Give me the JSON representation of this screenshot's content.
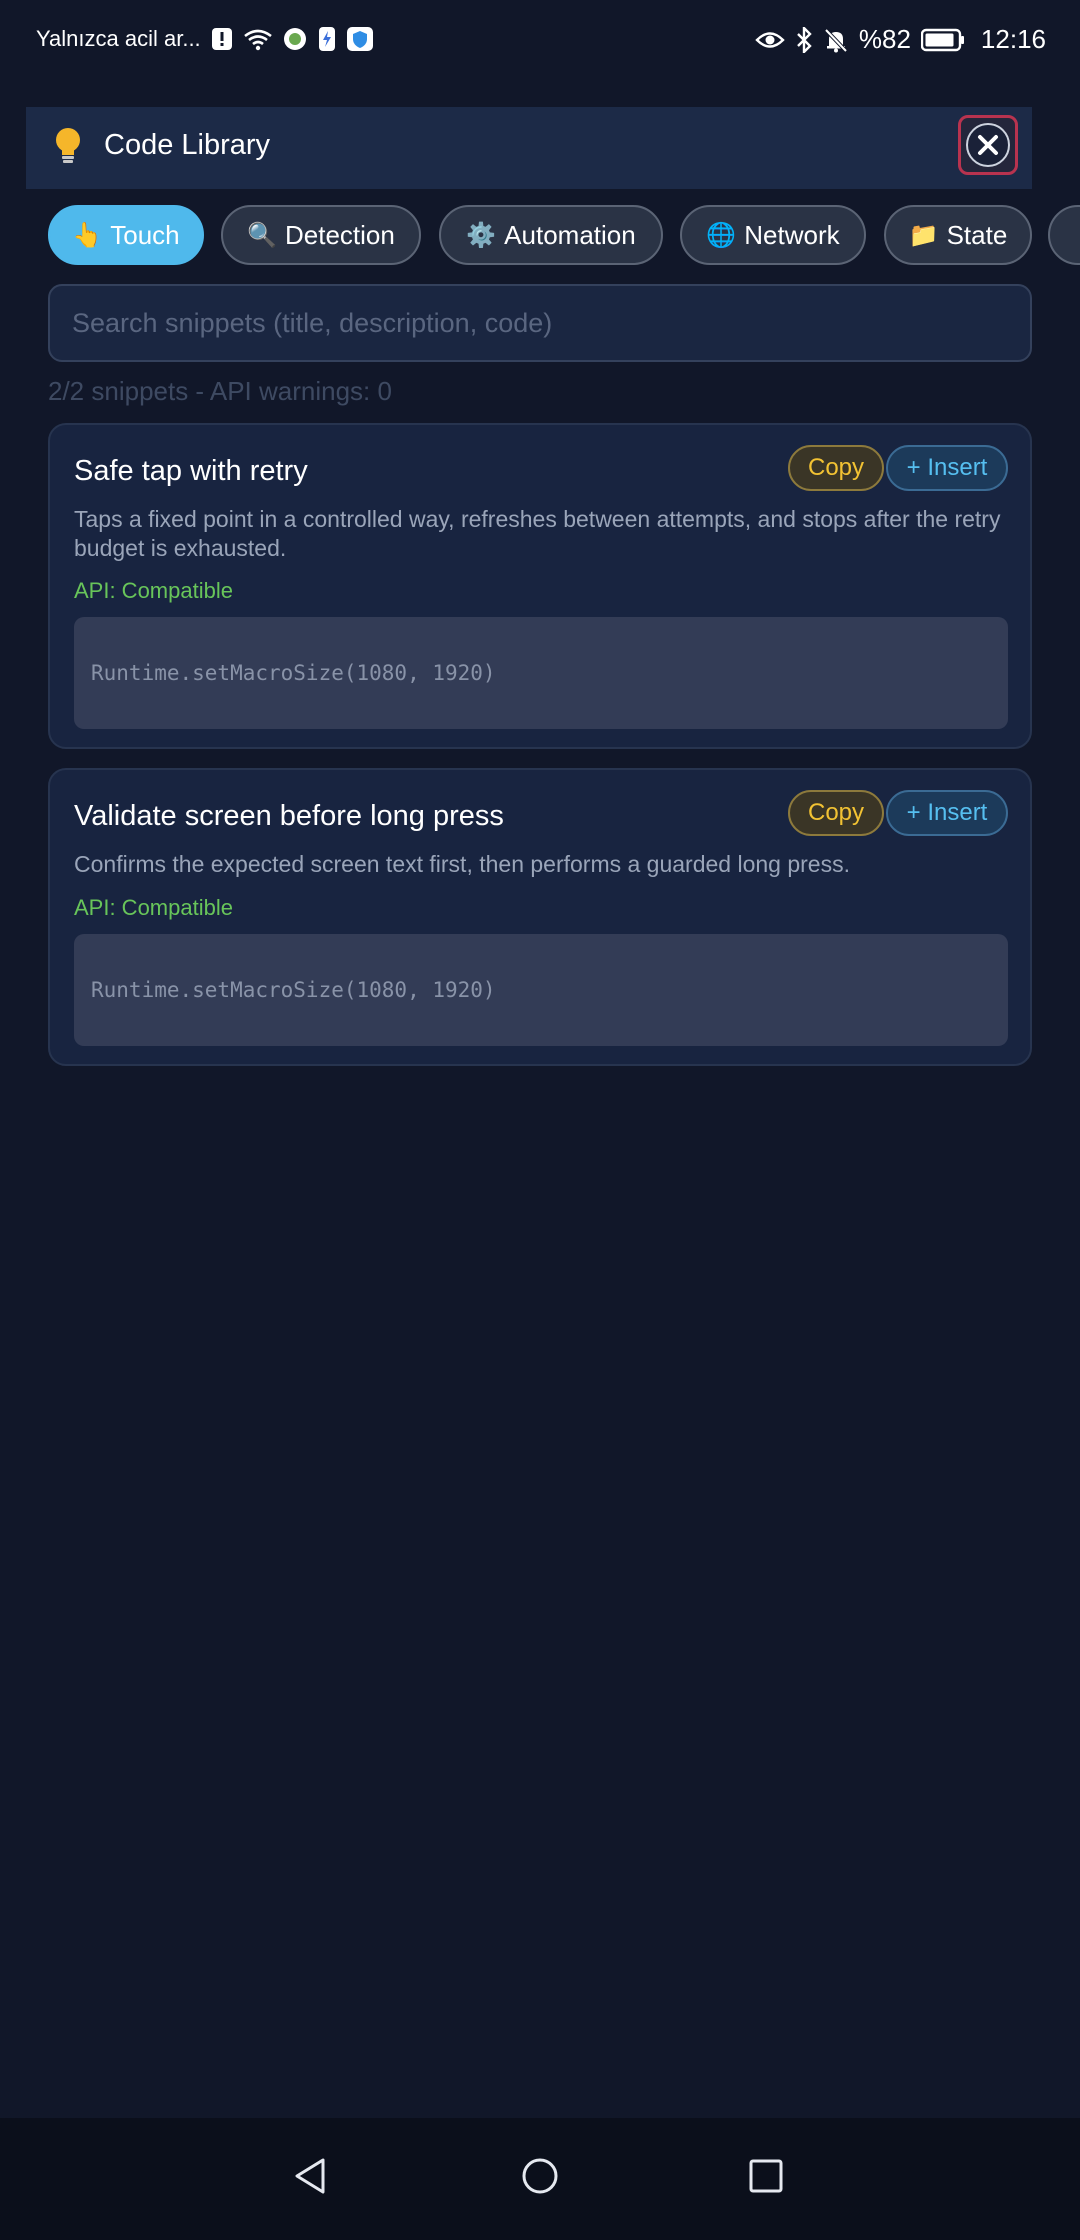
{
  "status_bar": {
    "carrier_text": "Yalnızca acil ar...",
    "battery": "%82",
    "time": "12:16"
  },
  "header": {
    "title": "Code Library",
    "icon": "lightbulb-icon",
    "close_icon": "close-icon"
  },
  "tabs": [
    {
      "emoji": "👆",
      "label": "Touch",
      "active": true
    },
    {
      "emoji": "🔍",
      "label": "Detection",
      "active": false
    },
    {
      "emoji": "⚙️",
      "label": "Automation",
      "active": false
    },
    {
      "emoji": "🌐",
      "label": "Network",
      "active": false
    },
    {
      "emoji": "📁",
      "label": "State",
      "active": false
    }
  ],
  "search": {
    "placeholder": "Search snippets (title, description, code)",
    "value": ""
  },
  "summary": "2/2 snippets - API warnings: 0",
  "snippets": [
    {
      "title": "Safe tap with retry",
      "copy_label": "Copy",
      "insert_label": "+ Insert",
      "description": "Taps a fixed point in a controlled way, refreshes between attempts, and stops after the retry budget is exhausted.",
      "api": "API: Compatible",
      "code": "Runtime.setMacroSize(1080, 1920)"
    },
    {
      "title": "Validate screen before long press",
      "copy_label": "Copy",
      "insert_label": "+ Insert",
      "description": "Confirms the expected screen text first, then performs a guarded long press.",
      "api": "API: Compatible",
      "code": "Runtime.setMacroSize(1080, 1920)"
    }
  ],
  "nav": {
    "back_icon": "back-triangle-icon",
    "home_icon": "home-circle-icon",
    "recents_icon": "recents-square-icon"
  },
  "colors": {
    "background": "#111729",
    "accent": "#4fb9ec",
    "copy": "#f2c233",
    "compatible": "#68c55a"
  }
}
